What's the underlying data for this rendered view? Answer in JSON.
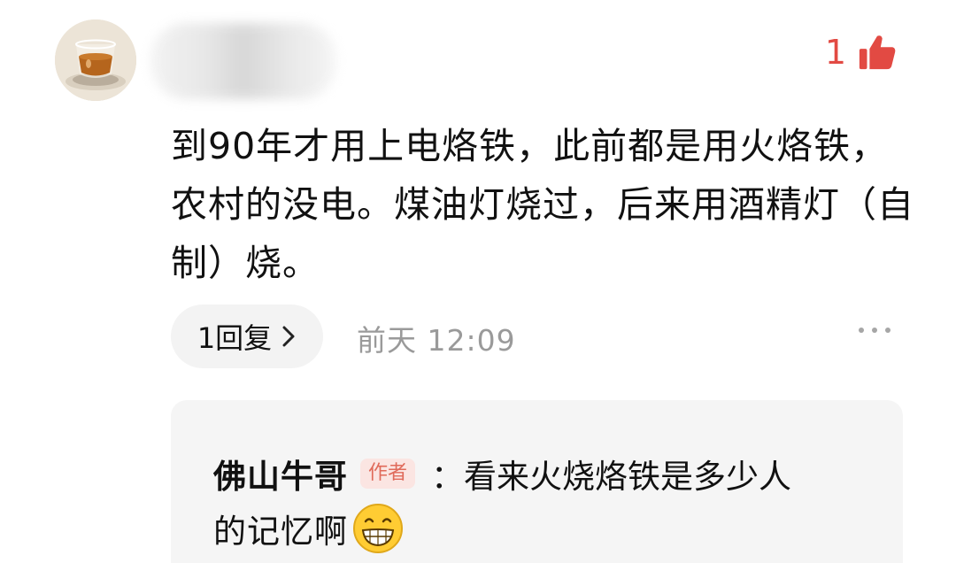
{
  "comment": {
    "like_count": "1",
    "text": "到90年才用上电烙铁，此前都是用火烙铁，农村的没电。煤油灯烧过，后来用酒精灯（自制）烧。",
    "reply_count_label": "1回复",
    "time": "前天  12:09"
  },
  "reply": {
    "author": "佛山牛哥",
    "badge": "作者",
    "colon": "：",
    "line1_text": "看来火烧烙铁是多少人",
    "line2_text": "的记忆啊"
  },
  "icons": {
    "avatar": "avatar-tea-glass-image",
    "like": "thumbs-up-icon",
    "chevron": "chevron-right-icon",
    "more": "more-dots-icon",
    "emoji": "grinning-face-emoji"
  },
  "colors": {
    "like": "#e24a43",
    "timestamp": "#9a9a9a",
    "badge_text": "#e06a5a",
    "badge_bg": "#fbe5e2",
    "reply_bg": "#f5f5f5"
  }
}
